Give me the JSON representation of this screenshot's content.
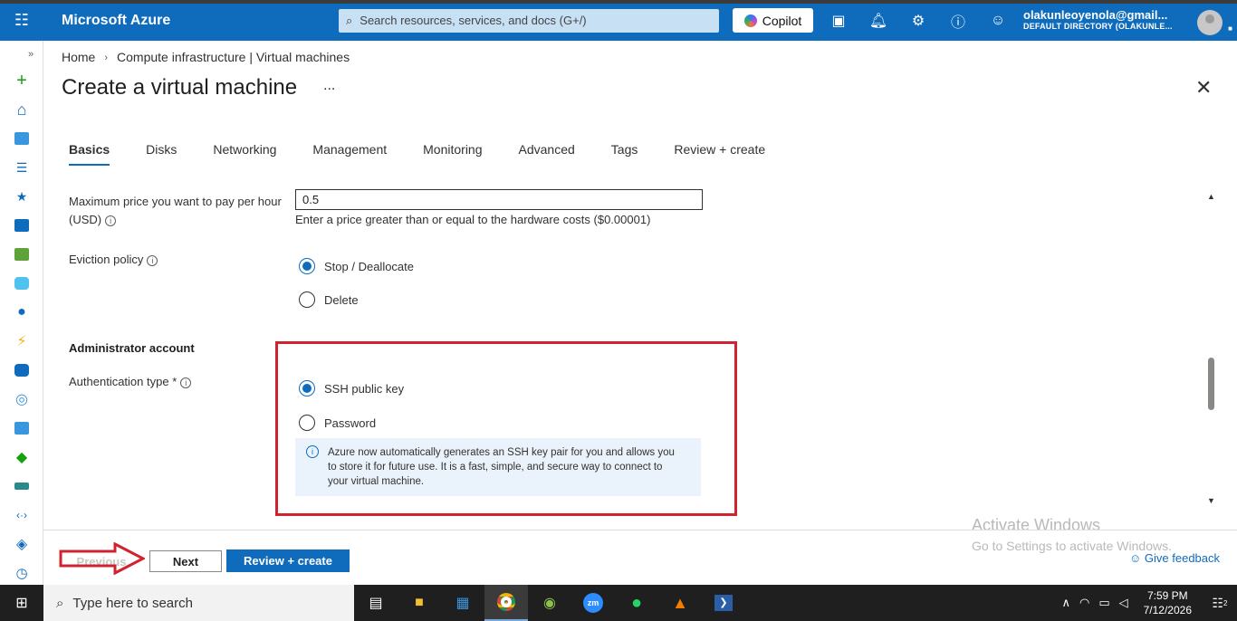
{
  "topbar": {
    "brand": "Microsoft Azure",
    "search_placeholder": "Search resources, services, and docs (G+/)",
    "copilot_label": "Copilot",
    "account_email": "olakunleoyenola@gmail...",
    "account_directory": "DEFAULT DIRECTORY (OLAKUNLE..."
  },
  "breadcrumb": {
    "home": "Home",
    "current": "Compute infrastructure | Virtual machines"
  },
  "page": {
    "title": "Create a virtual machine",
    "more": "...",
    "close": "✕"
  },
  "tabs": [
    "Basics",
    "Disks",
    "Networking",
    "Management",
    "Monitoring",
    "Advanced",
    "Tags",
    "Review + create"
  ],
  "form": {
    "max_price_label_line1": "Maximum price you want to pay per hour",
    "max_price_label_line2": "(USD)",
    "max_price_value": "0.5",
    "max_price_hint": "Enter a price greater than or equal to the hardware costs ($0.00001)",
    "eviction_label": "Eviction policy",
    "eviction_options": [
      "Stop / Deallocate",
      "Delete"
    ],
    "admin_section": "Administrator account",
    "auth_label": "Authentication type *",
    "auth_options": [
      "SSH public key",
      "Password"
    ],
    "ssh_info_line1": "Azure now automatically generates an SSH key pair for you and allows you",
    "ssh_info_line2": "to store it for future use. It is a fast, simple, and secure way to connect to",
    "ssh_info_line3": "your virtual machine."
  },
  "footer": {
    "previous": "Previous",
    "next": "Next",
    "review": "Review + create",
    "feedback": "Give feedback"
  },
  "watermark": {
    "line1": "Activate Windows",
    "line2": "Go to Settings to activate Windows."
  },
  "taskbar": {
    "search_placeholder": "Type here to search",
    "time": "7:59 PM",
    "date": "7/12/2026",
    "notifications": "2"
  },
  "colors": {
    "azure_blue": "#0f6cbd",
    "highlight_red": "#d1232f"
  }
}
